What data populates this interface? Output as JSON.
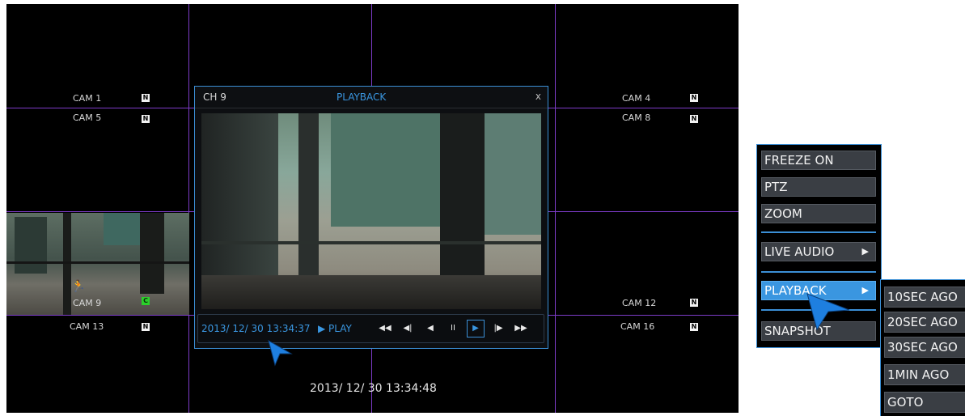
{
  "dvr": {
    "cams": {
      "cam1": "CAM 1",
      "cam4": "CAM 4",
      "cam5": "CAM 5",
      "cam8": "CAM 8",
      "cam9": "CAM 9",
      "cam12": "CAM 12",
      "cam13": "CAM 13",
      "cam16": "CAM 16"
    },
    "badge_n": "N",
    "badge_c": "C",
    "clock": "2013/ 12/ 30 13:34:48"
  },
  "playback_popup": {
    "channel": "CH 9",
    "title": "PLAYBACK",
    "close": "x",
    "timestamp": "2013/ 12/ 30  13:34:37",
    "play_state": "▶ PLAY",
    "controls": {
      "fast_rewind": "◀◀",
      "step_back": "◀|",
      "reverse_play": "◀",
      "pause": "II",
      "play": "▶",
      "step_forward": "|▶",
      "fast_forward": "▶▶"
    }
  },
  "context_menu": {
    "items": {
      "freeze": "FREEZE ON",
      "ptz": "PTZ",
      "zoom": "ZOOM",
      "live_audio": "LIVE AUDIO",
      "playback": "PLAYBACK",
      "snapshot": "SNAPSHOT"
    },
    "submenu_arrow": "▶",
    "playback_submenu": {
      "sec10": "10SEC AGO",
      "sec20": "20SEC AGO",
      "sec30": "30SEC AGO",
      "min1": "1MIN AGO",
      "goto": "GOTO"
    }
  },
  "icons": [
    "motion-person-icon",
    "mouse-cursor-icon"
  ],
  "colors": {
    "accent": "#3a96e0",
    "grid": "#7d3cc8",
    "record_badge": "#2ad12a"
  }
}
